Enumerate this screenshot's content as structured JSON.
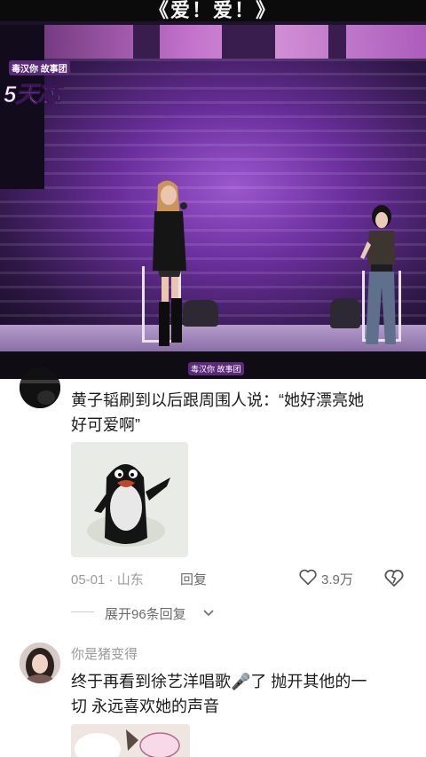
{
  "video": {
    "title": "《爱！爱！》",
    "show_logo_sub": "毒汉你  故事团",
    "show_logo_main": "5天芯",
    "watermark": "毒汉你  故事团"
  },
  "comments": [
    {
      "text_line1": "黄子韬刷到以后跟周围人说：“她好漂亮她",
      "text_line2": "好可爱啊”",
      "date_location": "05-01 · 山东",
      "reply_label": "回复",
      "like_count": "3.9万",
      "expand_label": "展开96条回复"
    },
    {
      "username": "你是猪变得",
      "text_line1": "终于再看到徐艺洋唱歌🎤了 抛开其他的一",
      "text_line2": "切 永远喜欢她的声音"
    }
  ],
  "icons": {
    "like": "heart-outline-icon",
    "dislike": "broken-heart-icon",
    "expand": "chevron-down-icon"
  },
  "colors": {
    "text": "#1a1a1a",
    "meta": "#9a9a9a",
    "stage_purple": "#6a2e9c"
  }
}
